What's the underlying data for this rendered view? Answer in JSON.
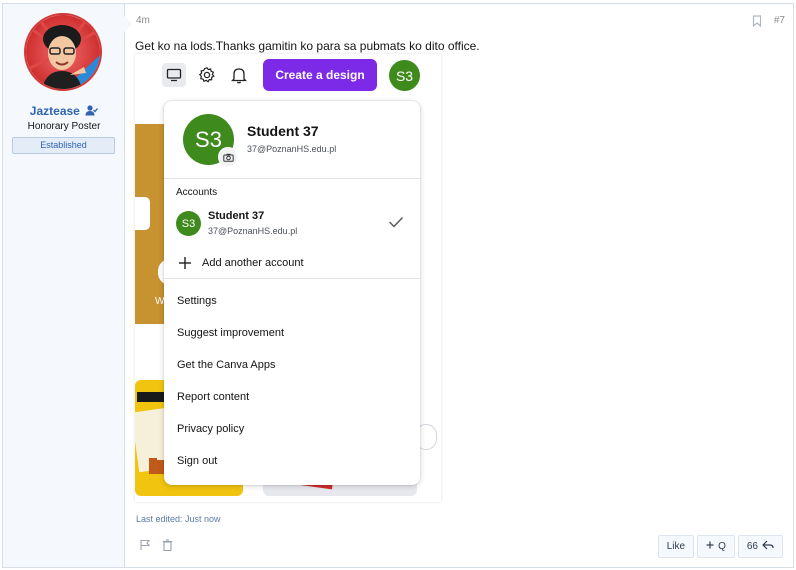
{
  "user": {
    "name": "Jaztease",
    "title": "Honorary Poster",
    "banner": "Established"
  },
  "post": {
    "time": "4m",
    "number": "#7",
    "message": "Get ko na lods.Thanks gamitin ko para sa pubmats ko dito office.",
    "last_edited": "Last edited: Just now"
  },
  "canva": {
    "create_button": "Create a design",
    "avatar_initials": "S3",
    "background_text": "W",
    "account": {
      "name": "Student 37",
      "email": "37@PoznanHS.edu.pl"
    },
    "accounts_label": "Accounts",
    "add_account": "Add another account",
    "menu": [
      "Settings",
      "Suggest improvement",
      "Get the Canva Apps",
      "Report content",
      "Privacy policy",
      "Sign out"
    ],
    "brand_color": "#7d2ae8",
    "avatar_color": "#3e8a1c"
  },
  "actions": {
    "like": "Like",
    "quote": "Q",
    "multi_quote": "66"
  }
}
